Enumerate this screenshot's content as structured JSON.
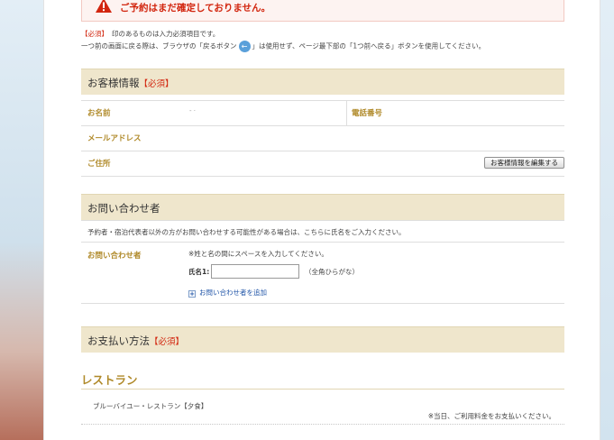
{
  "alert": {
    "icon": "warning-triangle-icon",
    "message": "ご予約はまだ確定しておりません。"
  },
  "notes": {
    "required_mark": "【必須】",
    "required_text": "印のあるものは入力必須項目です。",
    "back_before": "一つ前の画面に戻る際は、ブラウザの「戻るボタン",
    "back_after": "」は使用せず、ページ最下部の「1つ前へ戻る」ボタンを使用してください。"
  },
  "customer": {
    "title": "お客様情報",
    "required": "【必須】",
    "name_label": "お名前",
    "name_value": "- ·",
    "phone_label": "電話番号",
    "email_label": "メールアドレス",
    "address_label": "ご住所",
    "edit_button": "お客様情報を編集する"
  },
  "inquirer": {
    "title": "お問い合わせ者",
    "description": "予約者・宿泊代表者以外の方がお問い合わせする可能性がある場合は、こちらに氏名をご入力ください。",
    "label": "お問い合わせ者",
    "hint": "※姓と名の間にスペースを入力してください。",
    "name_label": "氏名1:",
    "name_value": "",
    "name_suffix": "（全角ひらがな）",
    "add_link": "お問い合わせ者を追加"
  },
  "payment": {
    "title": "お支払い方法",
    "required": "【必須】"
  },
  "restaurant": {
    "title": "レストラン",
    "item_name": "ブルーバイユー・レストラン【夕食】",
    "note": "※当日、ご利用料金をお支払いください。"
  },
  "colors": {
    "accent_gold": "#b08a2a",
    "alert_red": "#d2260f",
    "section_bg": "#efe6cc"
  }
}
